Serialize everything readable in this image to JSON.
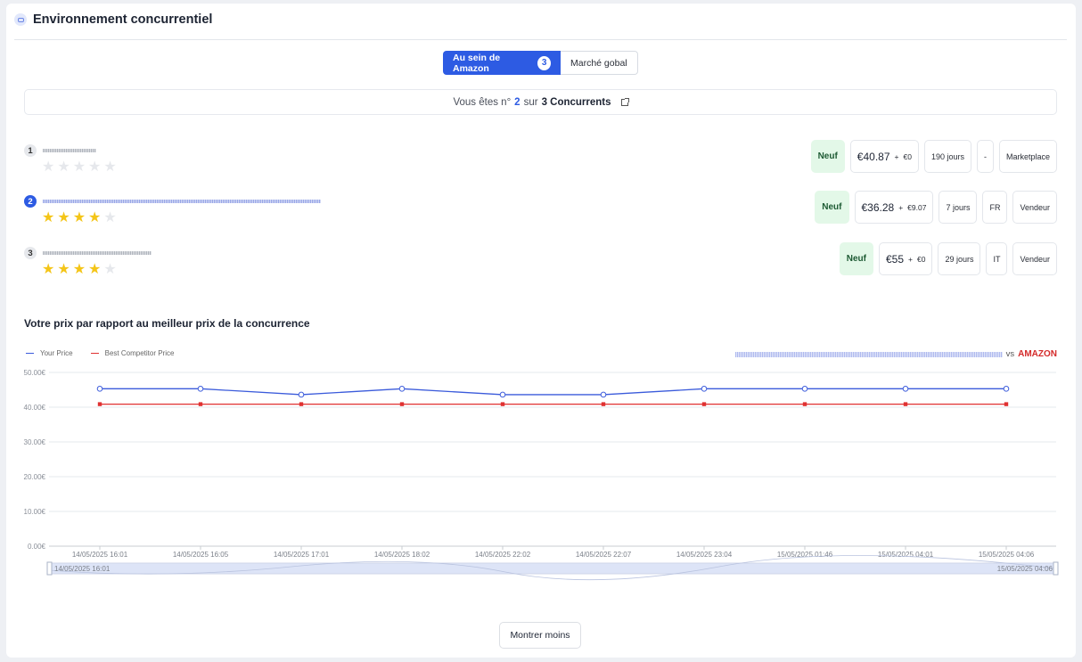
{
  "header": {
    "title": "Environnement concurrentiel",
    "icon": "globe-icon"
  },
  "toggle": {
    "active_label": "Au sein de Amazon",
    "active_count": "3",
    "other_label": "Marché gobal"
  },
  "rank": {
    "prefix": "Vous êtes n°",
    "position": "2",
    "middle": "sur",
    "total": "3 Concurrents"
  },
  "competitors": [
    {
      "rank": "1",
      "stars": 0,
      "condition": "Neuf",
      "price": "€40.87",
      "plus": "+",
      "shipping": "€0",
      "delay": "190 jours",
      "country": "-",
      "type": "Marketplace"
    },
    {
      "rank": "2",
      "stars": 4,
      "condition": "Neuf",
      "price": "€36.28",
      "plus": "+",
      "shipping": "€9.07",
      "delay": "7 jours",
      "country": "FR",
      "type": "Vendeur"
    },
    {
      "rank": "3",
      "stars": 4,
      "condition": "Neuf",
      "price": "€55",
      "plus": "+",
      "shipping": "€0",
      "delay": "29 jours",
      "country": "IT",
      "type": "Vendeur"
    }
  ],
  "section_title": "Votre prix par rapport au meilleur prix de la concurrence",
  "legend": {
    "your_price": "Your Price",
    "best_price": "Best Competitor Price"
  },
  "vs": {
    "vs": "vs",
    "amazon": "AMAZON"
  },
  "colors": {
    "accent": "#2d5be3",
    "your_price": "#3b5bdb",
    "best_price": "#e03131",
    "stars": "#f4c518",
    "new_badge_bg": "#e3f8e8"
  },
  "chart_data": {
    "type": "line",
    "x": [
      "14/05/2025 16:01",
      "14/05/2025 16:05",
      "14/05/2025 17:01",
      "14/05/2025 18:02",
      "14/05/2025 22:02",
      "14/05/2025 22:07",
      "14/05/2025 23:04",
      "15/05/2025 01:46",
      "15/05/2025 04:01",
      "15/05/2025 04:06"
    ],
    "series": [
      {
        "name": "Your Price",
        "values": [
          45.3,
          45.3,
          43.6,
          45.3,
          43.6,
          43.6,
          45.3,
          45.3,
          45.3,
          45.3
        ]
      },
      {
        "name": "Best Competitor Price",
        "values": [
          40.87,
          40.87,
          40.87,
          40.87,
          40.87,
          40.87,
          40.87,
          40.87,
          40.87,
          40.87
        ]
      }
    ],
    "yticks": [
      "0.00€",
      "10.00€",
      "20.00€",
      "30.00€",
      "40.00€",
      "50.00€"
    ],
    "ylim": [
      0,
      50
    ],
    "grid": true,
    "legend_position": "top-left",
    "zoom_start": "14/05/2025 16:01",
    "zoom_end": "15/05/2025 04:06"
  },
  "buttons": {
    "show_less": "Montrer moins"
  }
}
